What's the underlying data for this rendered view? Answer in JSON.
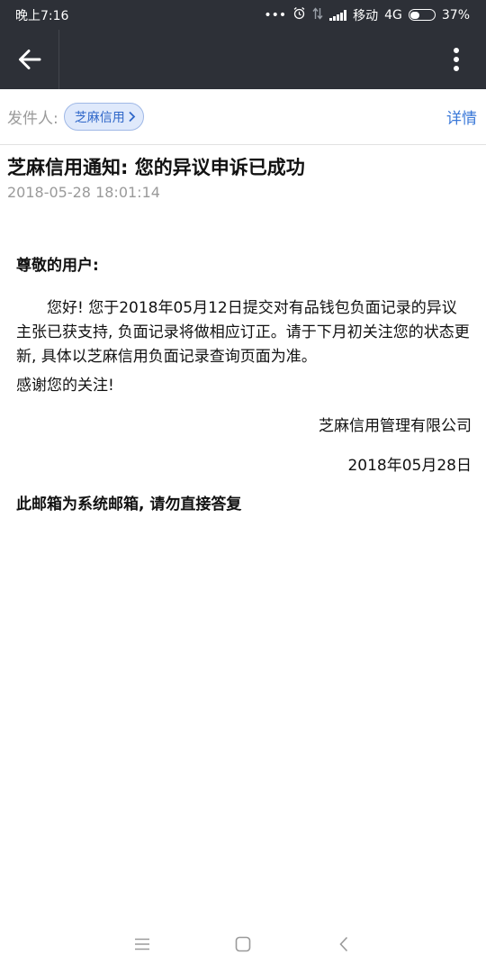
{
  "status_bar": {
    "time": "晚上7:16",
    "dots": "•••",
    "carrier": "移动",
    "network": "4G",
    "battery_level": 0.37,
    "battery_text": "37%"
  },
  "toolbar": {
    "back_icon": "arrow-left-icon",
    "more_icon": "more-vertical-icon"
  },
  "sender": {
    "label": "发件人:",
    "name": "芝麻信用",
    "details": "详情"
  },
  "email": {
    "subject": "芝麻信用通知: 您的异议申诉已成功",
    "timestamp": "2018-05-28 18:01:14",
    "greeting": "尊敬的用户:",
    "paragraph1": "您好! 您于2018年05月12日提交对有品钱包负面记录的异议主张已获支持, 负面记录将做相应订正。请于下月初关注您的状态更新, 具体以芝麻信用负面记录查询页面为准。",
    "thanks": "感谢您的关注!",
    "company": "芝麻信用管理有限公司",
    "date": "2018年05月28日",
    "footer_note": "此邮箱为系统邮箱, 请勿直接答复"
  },
  "colors": {
    "header_bg": "#2d3037",
    "link": "#3a78d8",
    "chip_bg": "#dfe9fb",
    "chip_text": "#2f67c9"
  }
}
